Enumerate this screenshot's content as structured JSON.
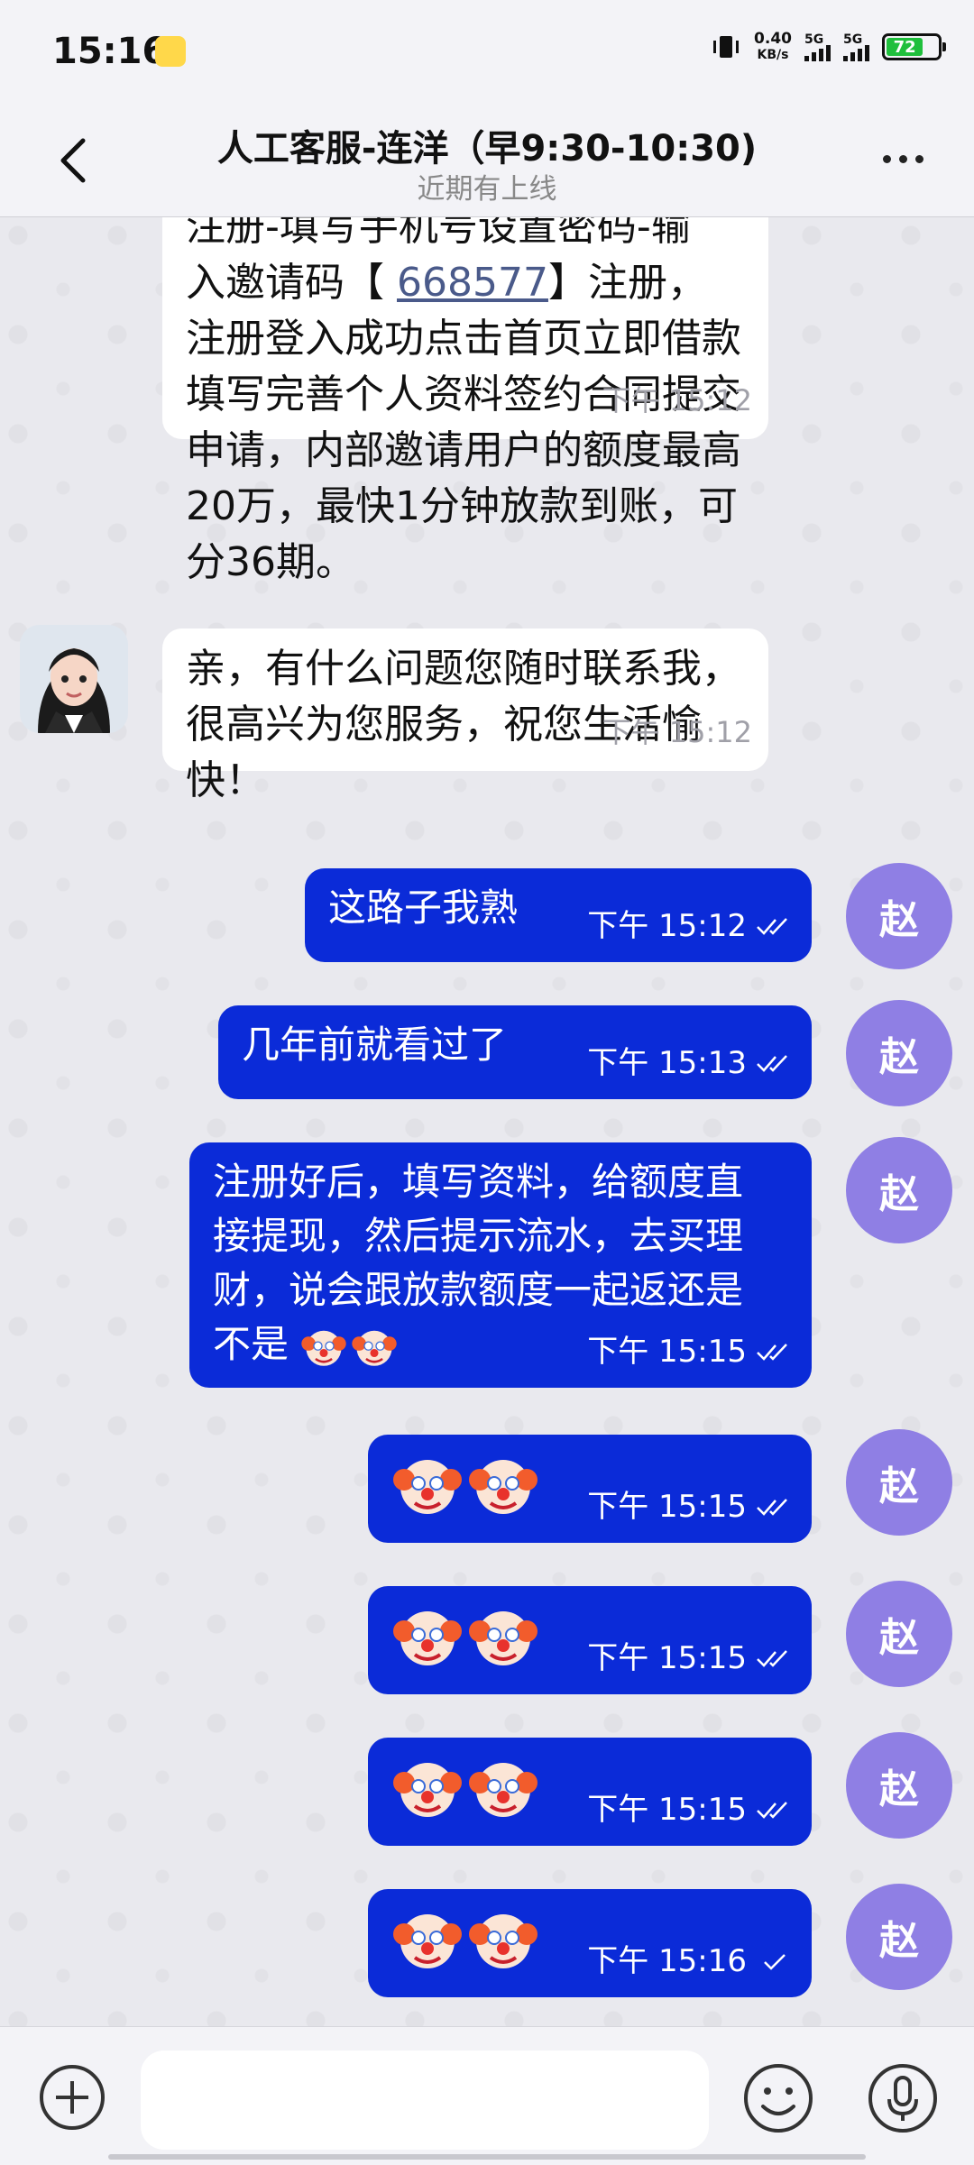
{
  "status": {
    "time": "15:16",
    "speed_value": "0.40",
    "speed_unit": "KB/s",
    "net1": "5G",
    "net2": "5G",
    "battery": "72"
  },
  "header": {
    "title": "人工客服-连洋（早9:30-10:30)",
    "subtitle": "近期有上线"
  },
  "messages": {
    "m1": {
      "line1": "注册-填写手机号设置密码-输",
      "line2_pre": "入邀请码【 ",
      "code": "668577",
      "line2_post": "】注册，",
      "rest": "注册登入成功点击首页立即借款填写完善个人资料签约合同提交申请，内部邀请用户的额度最高20万，最快1分钟放款到账，可分36期。",
      "time": "下午  15:12"
    },
    "m2": {
      "text": "亲，有什么问题您随时联系我，很高兴为您服务，祝您生活愉快！",
      "time": "下午  15:12"
    },
    "m3": {
      "text": "这路子我熟",
      "time": "下午  15:12"
    },
    "m4": {
      "text": "几年前就看过了",
      "time": "下午  15:13"
    },
    "m5": {
      "text": "注册好后，填写资料，给额度直接提现，然后提示流水，去买理财，说会跟放款额度一起返还是不是",
      "time": "下午  15:15"
    },
    "m6": {
      "time": "下午  15:15"
    },
    "m7": {
      "time": "下午  15:15"
    },
    "m8": {
      "time": "下午  15:15"
    },
    "m9": {
      "time": "下午  15:16"
    }
  },
  "me": {
    "avatar_text": "赵"
  },
  "input": {
    "placeholder": ""
  }
}
